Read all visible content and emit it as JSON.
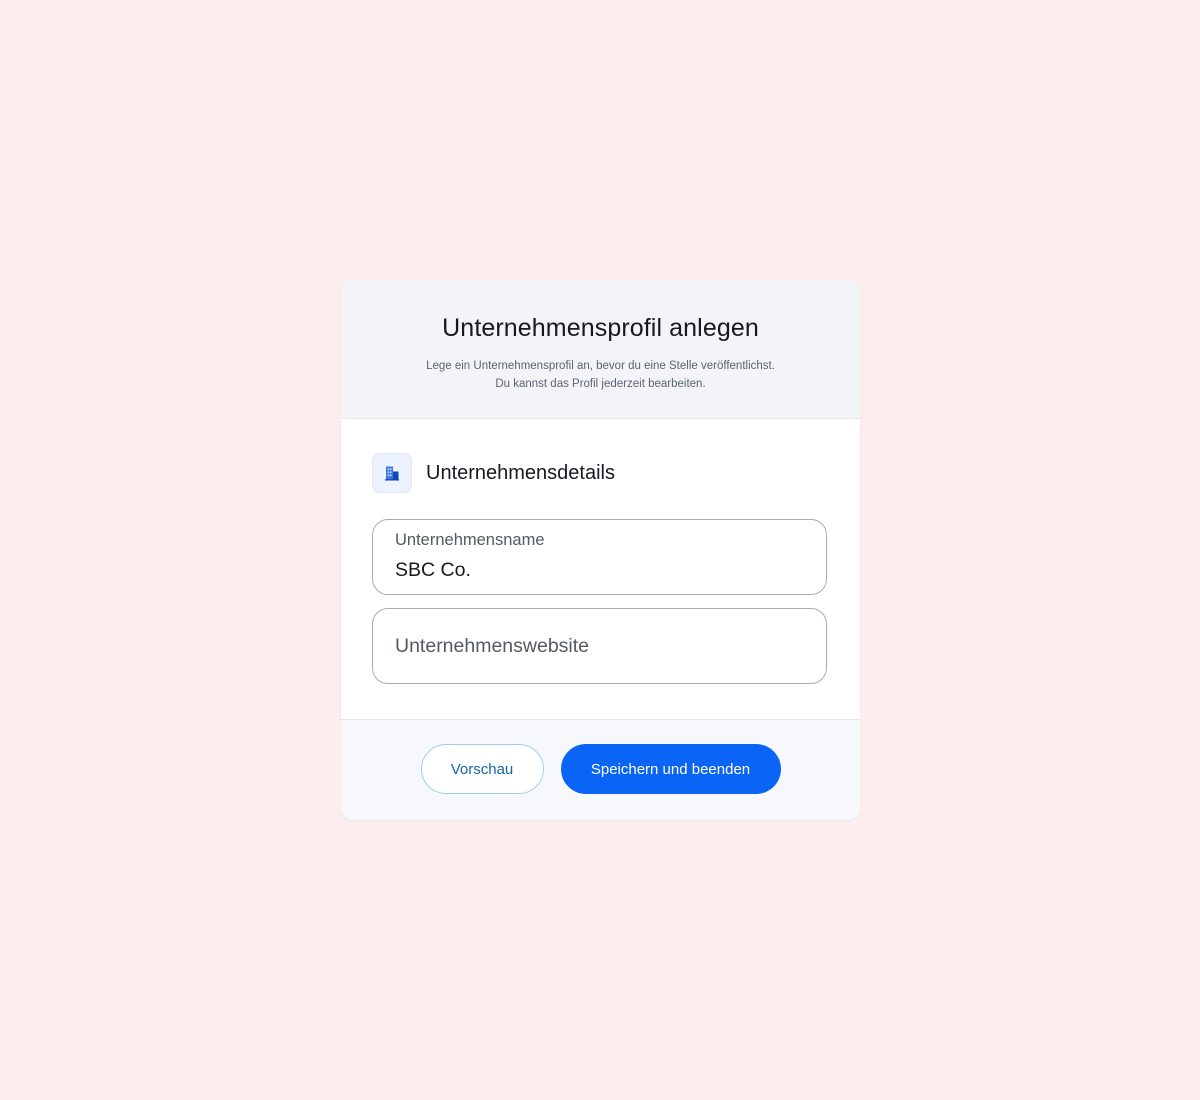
{
  "modal": {
    "title": "Unternehmensprofil anlegen",
    "subtitle_line1": "Lege ein Unternehmensprofil an, bevor du eine Stelle veröffentlichst.",
    "subtitle_line2": "Du kannst das Profil jederzeit bearbeiten."
  },
  "section": {
    "icon": "building-icon",
    "title": "Unternehmensdetails"
  },
  "fields": {
    "company_name": {
      "label": "Unternehmensname",
      "value": "SBC Co."
    },
    "company_website": {
      "placeholder": "Unternehmenswebsite",
      "value": ""
    }
  },
  "footer": {
    "preview_label": "Vorschau",
    "save_label": "Speichern und beenden"
  },
  "colors": {
    "page_background": "#fcedef",
    "primary": "#0a64f5",
    "secondary_border": "#9ed0ea",
    "secondary_text": "#1466a8"
  }
}
